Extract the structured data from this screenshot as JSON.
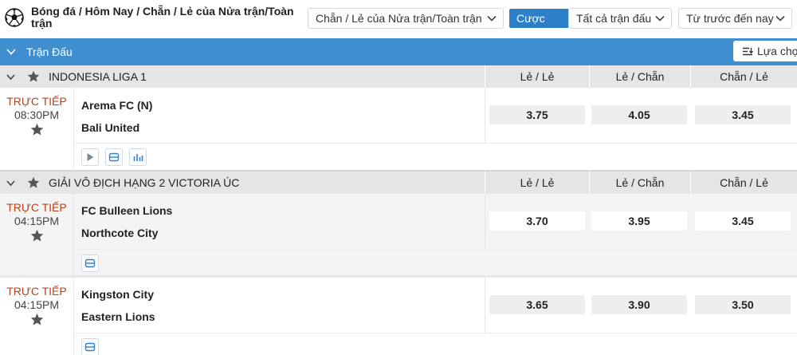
{
  "header": {
    "icon": "soccer-ball-icon",
    "breadcrumb": "Bóng đá / Hôm Nay / Chẵn / Lẻ của Nửa trận/Toàn trận",
    "market_select": "Chẵn / Lẻ của Nửa trận/Toàn trận",
    "parlay_button": "Cược Xiên",
    "matches_select": "Tất cả trận đấu",
    "sort_select": "Từ trước đến nay"
  },
  "bar": {
    "title": "Trận Đấu",
    "select_button": "Lựa chọn"
  },
  "leagues": [
    {
      "name": "INDONESIA LIGA 1",
      "columns": [
        "Lẻ / Lẻ",
        "Lẻ / Chẵn",
        "Chẵn / Lẻ"
      ],
      "matches": [
        {
          "status": "TRỰC TIẾP",
          "time": "08:30PM",
          "home": "Arema FC (N)",
          "away": "Bali United",
          "odds": [
            "3.75",
            "4.05",
            "3.45"
          ],
          "tools": [
            "play-icon",
            "scoreboard-icon",
            "stats-icon"
          ]
        }
      ]
    },
    {
      "name": "GIẢI VÔ ĐỊCH HẠNG 2 VICTORIA ÚC",
      "columns": [
        "Lẻ / Lẻ",
        "Lẻ / Chẵn",
        "Chẵn / Lẻ"
      ],
      "matches": [
        {
          "status": "TRỰC TIẾP",
          "time": "04:15PM",
          "home": "FC Bulleen Lions",
          "away": "Northcote City",
          "odds": [
            "3.70",
            "3.95",
            "3.45"
          ],
          "tools": [
            "scoreboard-icon"
          ]
        },
        {
          "status": "TRỰC TIẾP",
          "time": "04:15PM",
          "home": "Kingston City",
          "away": "Eastern Lions",
          "odds": [
            "3.65",
            "3.90",
            "3.50"
          ],
          "tools": [
            "scoreboard-icon"
          ]
        }
      ]
    }
  ],
  "colors": {
    "accent_blue": "#3f8fd0",
    "button_blue": "#2d80c8",
    "live_red": "#b8411d",
    "league_bg": "#e5e5e5",
    "odds_bg": "#eeeeee"
  }
}
